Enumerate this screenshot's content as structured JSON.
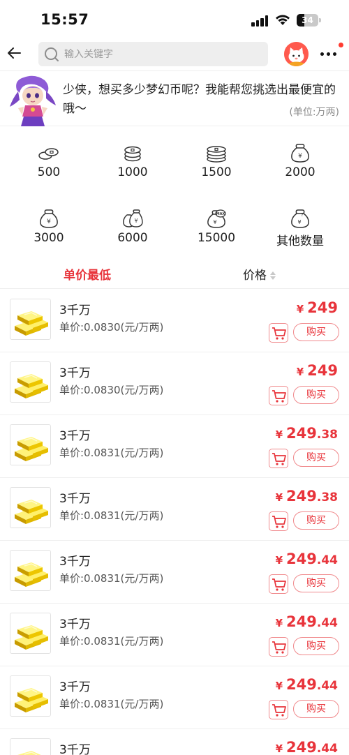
{
  "status_bar": {
    "time": "15:57",
    "battery": "34",
    "battery_level": 0.34
  },
  "header": {
    "search_placeholder": "输入关键字",
    "back_icon": "arrow-left-icon",
    "more_icon": "more-dots-icon"
  },
  "banner": {
    "message": "少侠，想买多少梦幻币呢？我能帮您挑选出最便宜的哦～",
    "unit": "(单位:万两)"
  },
  "quantities": [
    {
      "label": "500",
      "icon": "coins-small-icon"
    },
    {
      "label": "1000",
      "icon": "coins-stack-icon"
    },
    {
      "label": "1500",
      "icon": "coins-pile-icon"
    },
    {
      "label": "2000",
      "icon": "money-bag-icon"
    },
    {
      "label": "3000",
      "icon": "money-bag-yuan-icon"
    },
    {
      "label": "6000",
      "icon": "money-bag-double-icon"
    },
    {
      "label": "15000",
      "icon": "money-bag-max-icon"
    },
    {
      "label": "其他数量",
      "icon": "money-bag-question-icon"
    }
  ],
  "sort": {
    "tab_lowest_unit": "单价最低",
    "tab_price": "价格"
  },
  "products": [
    {
      "title": "3千万",
      "unit_price": "单价:0.0830(元/万两)",
      "currency": "¥",
      "price_int": "249",
      "price_dec": "",
      "buy_label": "购买"
    },
    {
      "title": "3千万",
      "unit_price": "单价:0.0830(元/万两)",
      "currency": "¥",
      "price_int": "249",
      "price_dec": "",
      "buy_label": "购买"
    },
    {
      "title": "3千万",
      "unit_price": "单价:0.0831(元/万两)",
      "currency": "¥",
      "price_int": "249",
      "price_dec": ".38",
      "buy_label": "购买"
    },
    {
      "title": "3千万",
      "unit_price": "单价:0.0831(元/万两)",
      "currency": "¥",
      "price_int": "249",
      "price_dec": ".38",
      "buy_label": "购买"
    },
    {
      "title": "3千万",
      "unit_price": "单价:0.0831(元/万两)",
      "currency": "¥",
      "price_int": "249",
      "price_dec": ".44",
      "buy_label": "购买"
    },
    {
      "title": "3千万",
      "unit_price": "单价:0.0831(元/万两)",
      "currency": "¥",
      "price_int": "249",
      "price_dec": ".44",
      "buy_label": "购买"
    },
    {
      "title": "3千万",
      "unit_price": "单价:0.0831(元/万两)",
      "currency": "¥",
      "price_int": "249",
      "price_dec": ".44",
      "buy_label": "购买"
    },
    {
      "title": "3千万",
      "unit_price": "单价:0.0831(元/万两)",
      "currency": "¥",
      "price_int": "249",
      "price_dec": ".44",
      "buy_label": "购买"
    }
  ],
  "colors": {
    "accent": "#e8343b",
    "gold": "#f2c400",
    "divider": "#efefef"
  }
}
